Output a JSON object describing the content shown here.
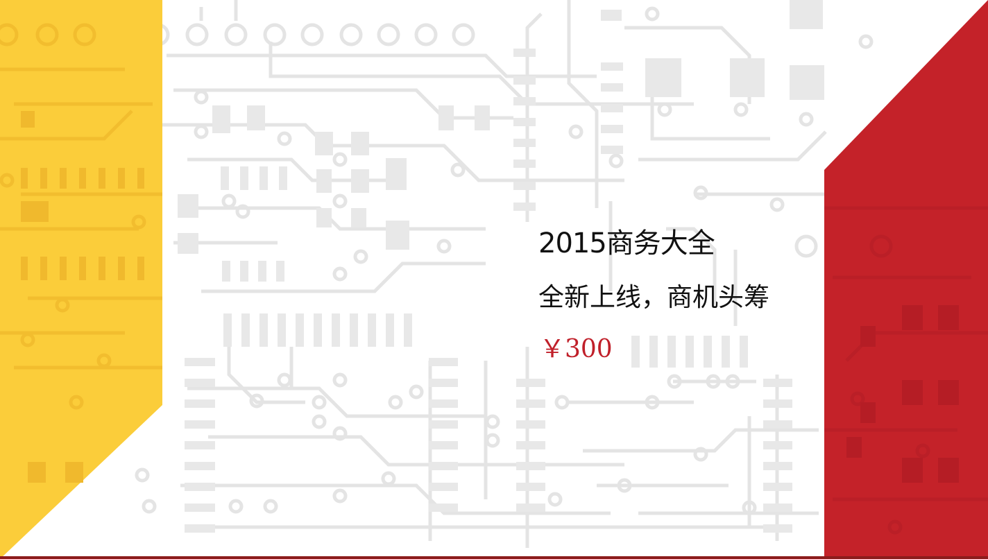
{
  "slide": {
    "title": "2015商务大全",
    "subtitle": "全新上线，商机头筹",
    "price": "￥300"
  },
  "colors": {
    "accent_yellow": "#fbcd3a",
    "accent_red": "#c42229",
    "circuit_gray": "#e6e6e6",
    "text_dark": "#111111",
    "price_red": "#c0202a"
  },
  "decor": {
    "background_pattern": "circuit-board-pattern"
  }
}
